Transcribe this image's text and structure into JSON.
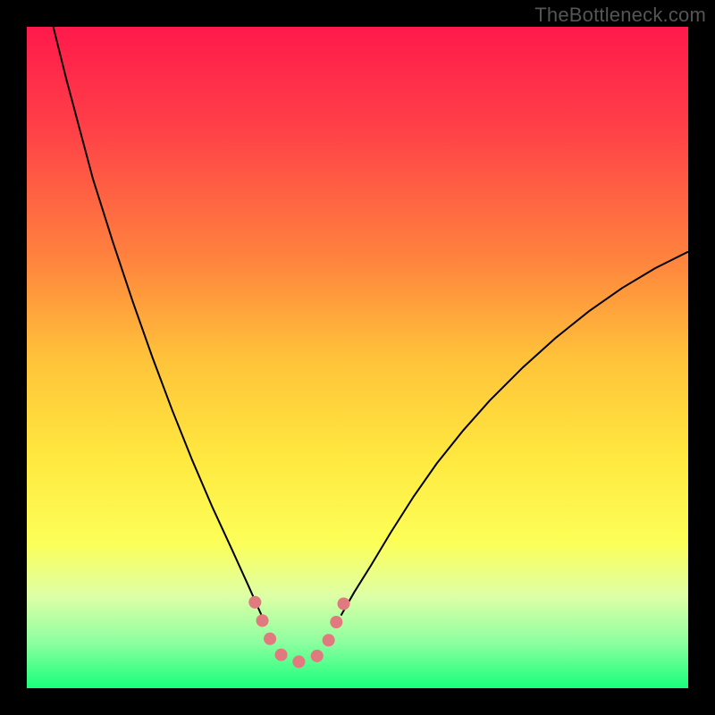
{
  "watermark": "TheBottleneck.com",
  "chart_data": {
    "type": "line",
    "title": "",
    "xlabel": "",
    "ylabel": "",
    "xlim": [
      0,
      100
    ],
    "ylim": [
      0,
      100
    ],
    "background_gradient": {
      "stops": [
        {
          "offset": 0.0,
          "color": "#ff1a4b"
        },
        {
          "offset": 0.15,
          "color": "#ff3f48"
        },
        {
          "offset": 0.35,
          "color": "#ff833e"
        },
        {
          "offset": 0.5,
          "color": "#ffc23a"
        },
        {
          "offset": 0.65,
          "color": "#ffe83f"
        },
        {
          "offset": 0.78,
          "color": "#fcff58"
        },
        {
          "offset": 0.86,
          "color": "#deffa6"
        },
        {
          "offset": 0.93,
          "color": "#8effa0"
        },
        {
          "offset": 1.0,
          "color": "#17ff7b"
        }
      ]
    },
    "series": [
      {
        "name": "left-curve",
        "stroke": "#000000",
        "stroke_width": 2,
        "points": [
          {
            "x": 4.0,
            "y": 100.0
          },
          {
            "x": 6.0,
            "y": 92.0
          },
          {
            "x": 8.0,
            "y": 84.5
          },
          {
            "x": 10.0,
            "y": 77.0
          },
          {
            "x": 13.0,
            "y": 67.5
          },
          {
            "x": 16.0,
            "y": 58.5
          },
          {
            "x": 19.0,
            "y": 50.0
          },
          {
            "x": 22.0,
            "y": 42.0
          },
          {
            "x": 25.0,
            "y": 34.5
          },
          {
            "x": 28.0,
            "y": 27.5
          },
          {
            "x": 31.0,
            "y": 21.0
          },
          {
            "x": 33.5,
            "y": 15.5
          },
          {
            "x": 35.5,
            "y": 11.0
          }
        ]
      },
      {
        "name": "right-curve",
        "stroke": "#000000",
        "stroke_width": 2,
        "points": [
          {
            "x": 47.5,
            "y": 11.0
          },
          {
            "x": 49.5,
            "y": 14.5
          },
          {
            "x": 52.0,
            "y": 18.5
          },
          {
            "x": 55.0,
            "y": 23.5
          },
          {
            "x": 58.5,
            "y": 29.0
          },
          {
            "x": 62.0,
            "y": 34.0
          },
          {
            "x": 66.0,
            "y": 39.0
          },
          {
            "x": 70.0,
            "y": 43.5
          },
          {
            "x": 75.0,
            "y": 48.5
          },
          {
            "x": 80.0,
            "y": 53.0
          },
          {
            "x": 85.0,
            "y": 57.0
          },
          {
            "x": 90.0,
            "y": 60.5
          },
          {
            "x": 95.0,
            "y": 63.5
          },
          {
            "x": 100.0,
            "y": 66.0
          }
        ]
      },
      {
        "name": "bottom-dotted",
        "stroke": "#e07a7f",
        "stroke_width": 14,
        "linecap": "round",
        "dasharray": "0.1 22",
        "points": [
          {
            "x": 34.5,
            "y": 13.0
          },
          {
            "x": 35.5,
            "y": 10.5
          },
          {
            "x": 36.5,
            "y": 8.0
          },
          {
            "x": 37.5,
            "y": 6.0
          },
          {
            "x": 39.0,
            "y": 4.5
          },
          {
            "x": 40.5,
            "y": 4.0
          },
          {
            "x": 42.0,
            "y": 4.0
          },
          {
            "x": 43.5,
            "y": 4.5
          },
          {
            "x": 45.0,
            "y": 6.0
          },
          {
            "x": 46.0,
            "y": 8.0
          },
          {
            "x": 47.0,
            "y": 10.5
          },
          {
            "x": 48.0,
            "y": 13.0
          }
        ]
      }
    ]
  }
}
